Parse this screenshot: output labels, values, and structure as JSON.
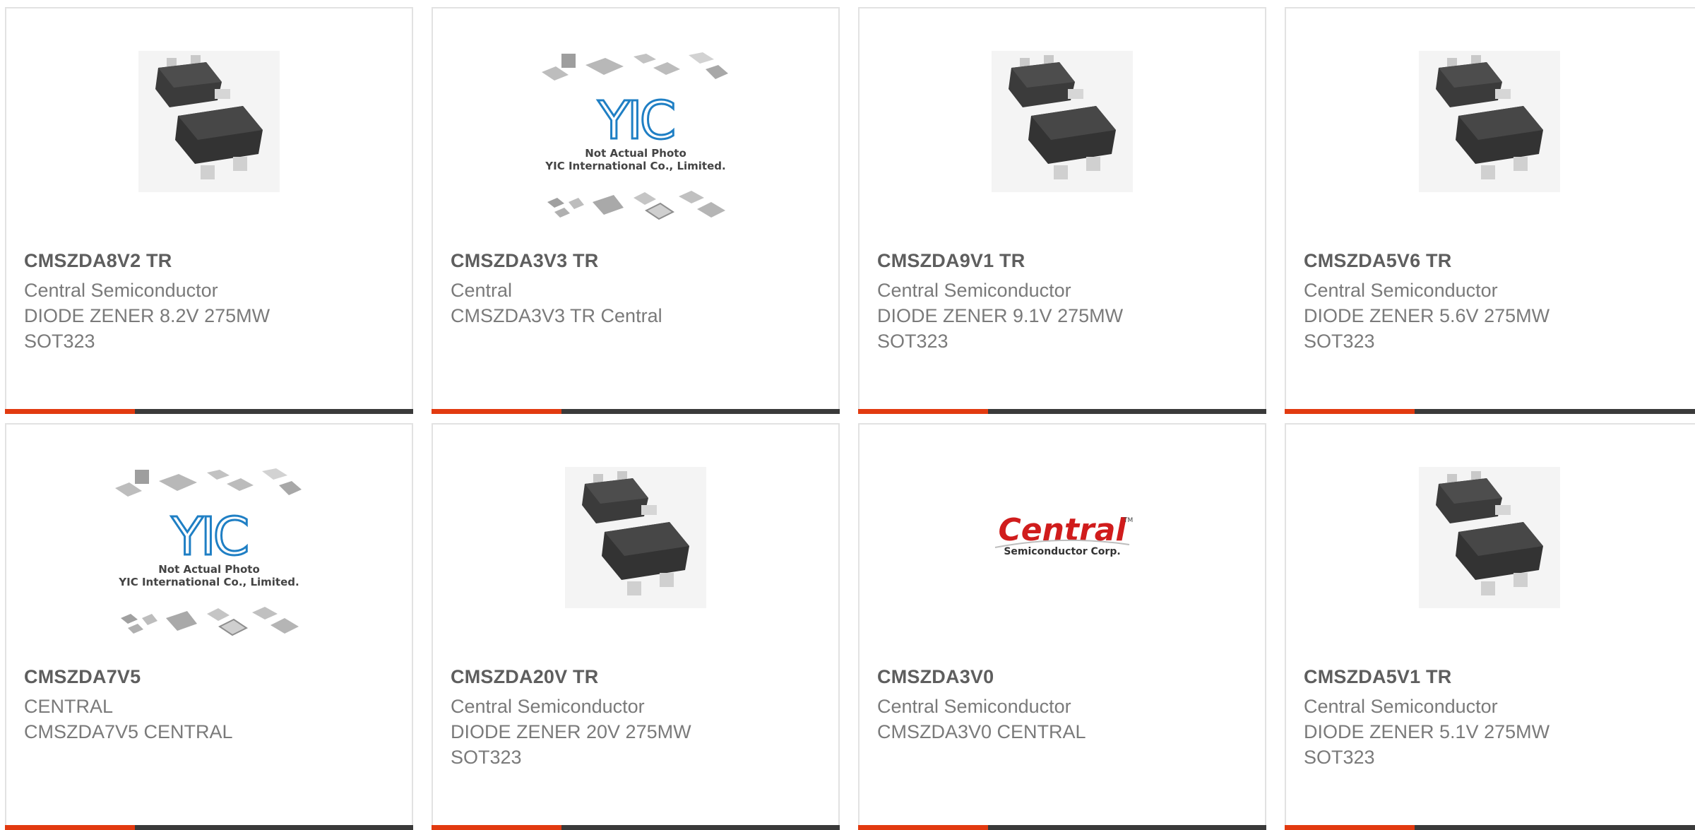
{
  "products": [
    {
      "part_number": "CMSZDA8V2 TR",
      "manufacturer": "Central Semiconductor",
      "description_lines": [
        "DIODE ZENER 8.2V 275MW",
        "SOT323"
      ],
      "image": "sot323-package-photo"
    },
    {
      "part_number": "CMSZDA3V3 TR",
      "manufacturer": "Central",
      "description_lines": [
        "CMSZDA3V3 TR Central"
      ],
      "image": "yic-placeholder-photo",
      "image_text": [
        "Not Actual Photo",
        "YIC International Co., Limited."
      ]
    },
    {
      "part_number": "CMSZDA9V1 TR",
      "manufacturer": "Central Semiconductor",
      "description_lines": [
        "DIODE ZENER 9.1V 275MW",
        "SOT323"
      ],
      "image": "sot323-package-photo"
    },
    {
      "part_number": "CMSZDA5V6 TR",
      "manufacturer": "Central Semiconductor",
      "description_lines": [
        "DIODE ZENER 5.6V 275MW",
        "SOT323"
      ],
      "image": "sot323-package-photo"
    },
    {
      "part_number": "CMSZDA7V5",
      "manufacturer": "CENTRAL",
      "description_lines": [
        "CMSZDA7V5 CENTRAL"
      ],
      "image": "yic-placeholder-photo",
      "image_text": [
        "Not Actual Photo",
        "YIC International Co., Limited."
      ]
    },
    {
      "part_number": "CMSZDA20V TR",
      "manufacturer": "Central Semiconductor",
      "description_lines": [
        "DIODE ZENER 20V 275MW",
        "SOT323"
      ],
      "image": "sot323-package-photo"
    },
    {
      "part_number": "CMSZDA3V0",
      "manufacturer": "Central Semiconductor",
      "description_lines": [
        "CMSZDA3V0 CENTRAL"
      ],
      "image": "central-semiconductor-logo",
      "image_text": [
        "Central",
        "Semiconductor Corp."
      ]
    },
    {
      "part_number": "CMSZDA5V1 TR",
      "manufacturer": "Central Semiconductor",
      "description_lines": [
        "DIODE ZENER 5.1V 275MW",
        "SOT323"
      ],
      "image": "sot323-package-photo"
    }
  ],
  "colors": {
    "accent": "#e23a10",
    "bar": "#3a3a3a",
    "border": "#e2e2e2",
    "part_text": "#5e5e5e",
    "info_text": "#7a7a7a",
    "yic_blue": "#1f7fc4",
    "central_red": "#d01c1c"
  }
}
